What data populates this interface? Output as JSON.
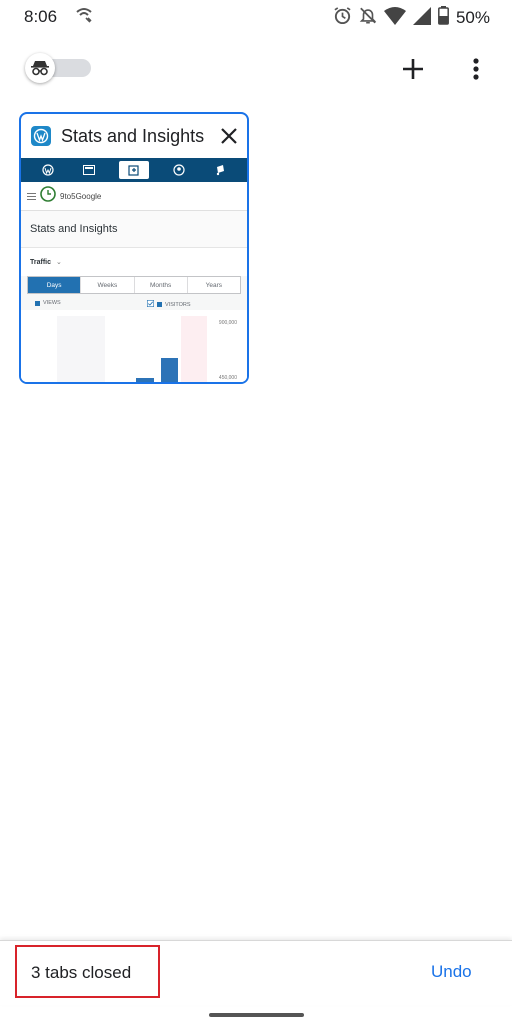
{
  "status_bar": {
    "time": "8:06",
    "battery": "50%",
    "icons": [
      "wifi-calling-icon",
      "alarm-icon",
      "notifications-off-icon",
      "wifi-icon",
      "signal-icon",
      "battery-icon"
    ]
  },
  "toolbar": {
    "incognito_toggle": "incognito-icon",
    "new_tab_icon": "plus-icon",
    "menu_icon": "more-vert-icon"
  },
  "tab": {
    "title": "Stats and Insights",
    "favicon": "wordpress-icon",
    "thumbnail": {
      "site_name": "9to5Google",
      "page_title": "Stats and Insights",
      "section": "Traffic",
      "periods": [
        "Days",
        "Weeks",
        "Months",
        "Years"
      ],
      "active_period": "Days",
      "legend": [
        "VIEWS",
        "VISITORS"
      ],
      "y_ticks": [
        "900,000",
        "450,000"
      ],
      "bar_values": [
        0.05,
        0.34
      ]
    }
  },
  "snackbar": {
    "message": "3 tabs closed",
    "action": "Undo"
  },
  "colors": {
    "accent": "#1a73e8",
    "highlight": "#d8232a",
    "wp_nav": "#0a4b78"
  }
}
